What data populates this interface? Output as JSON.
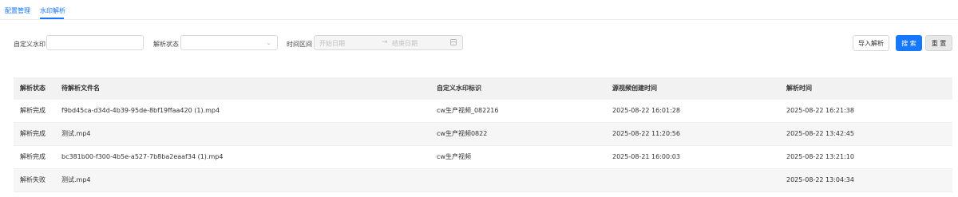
{
  "tabs": [
    {
      "label": "配置管理"
    },
    {
      "label": "水印解析"
    }
  ],
  "filters": {
    "custom_label": "自定义水印",
    "status_label": "解析状态",
    "range_label": "时间区间",
    "start_placeholder": "开始日期",
    "end_placeholder": "结束日期"
  },
  "buttons": {
    "import": "导入解析",
    "search": "搜 索",
    "reset": "重 置"
  },
  "table": {
    "headers": [
      "解析状态",
      "待解析文件名",
      "自定义水印标识",
      "源视频创建时间",
      "解析时间"
    ],
    "rows": [
      [
        "解析完成",
        "f9bd45ca-d34d-4b39-95de-8bf19ffaa420 (1).mp4",
        "cw生产视频_082216",
        "2025-08-22 16:01:28",
        "2025-08-22 16:21:38"
      ],
      [
        "解析完成",
        "测试.mp4",
        "cw生产视频0822",
        "2025-08-22 11:20:56",
        "2025-08-22 13:42:45"
      ],
      [
        "解析完成",
        "bc381b00-f300-4b5e-a527-7b8ba2eaaf34 (1).mp4",
        "cw生产视频",
        "2025-08-21 16:00:03",
        "2025-08-22 13:21:10"
      ],
      [
        "解析失败",
        "测试.mp4",
        "",
        "",
        "2025-08-22 13:04:34"
      ]
    ]
  }
}
